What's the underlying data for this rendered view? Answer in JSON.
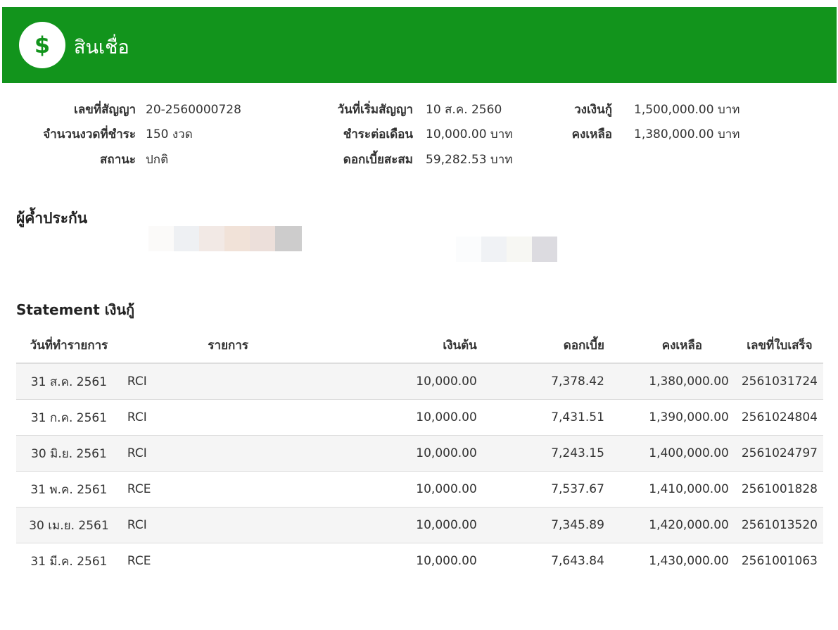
{
  "header": {
    "title": "สินเชื่อ",
    "icon": "dollar-icon",
    "brand_color": "#12941c"
  },
  "contract": {
    "number_label": "เลขที่สัญญา",
    "number_value": "20-2560000728",
    "installments_label": "จำนวนงวดที่ชำระ",
    "installments_value": "150 งวด",
    "status_label": "สถานะ",
    "status_value": "ปกติ",
    "start_label": "วันที่เริ่มสัญญา",
    "start_value": "10 ส.ค. 2560",
    "monthly_label": "ชำระต่อเดือน",
    "monthly_value": "10,000.00 บาท",
    "interest_label": "ดอกเบี้ยสะสม",
    "interest_value": "59,282.53 บาท",
    "limit_label": "วงเงินกู้",
    "limit_value": "1,500,000.00 บาท",
    "balance_label": "คงเหลือ",
    "balance_value": "1,380,000.00 บาท"
  },
  "guarantor": {
    "title": "ผู้ค้ำประกัน"
  },
  "statement": {
    "title": "Statement เงินกู้",
    "columns": [
      "วันที่ทำรายการ",
      "รายการ",
      "เงินต้น",
      "ดอกเบี้ย",
      "คงเหลือ",
      "เลขที่ใบเสร็จ"
    ],
    "rows": [
      [
        "31 ส.ค. 2561",
        "RCI",
        "10,000.00",
        "7,378.42",
        "1,380,000.00",
        "2561031724"
      ],
      [
        "31 ก.ค. 2561",
        "RCI",
        "10,000.00",
        "7,431.51",
        "1,390,000.00",
        "2561024804"
      ],
      [
        "30 มิ.ย. 2561",
        "RCI",
        "10,000.00",
        "7,243.15",
        "1,400,000.00",
        "2561024797"
      ],
      [
        "31 พ.ค. 2561",
        "RCE",
        "10,000.00",
        "7,537.67",
        "1,410,000.00",
        "2561001828"
      ],
      [
        "30 เม.ย. 2561",
        "RCI",
        "10,000.00",
        "7,345.89",
        "1,420,000.00",
        "2561013520"
      ],
      [
        "31 มี.ค. 2561",
        "RCE",
        "10,000.00",
        "7,643.84",
        "1,430,000.00",
        "2561001063"
      ]
    ]
  }
}
